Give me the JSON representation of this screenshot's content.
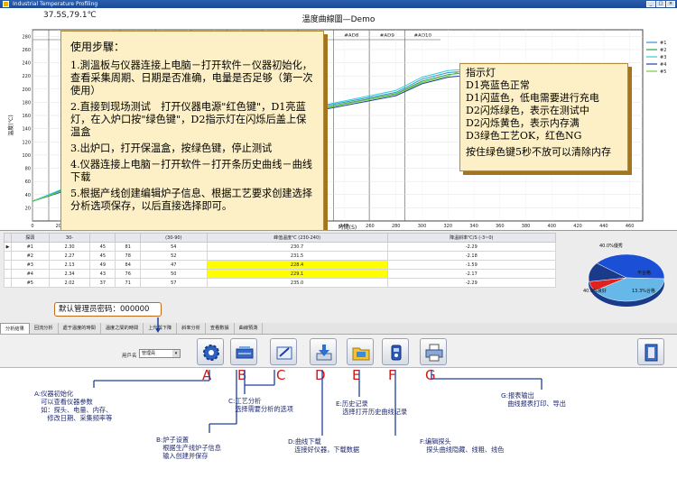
{
  "window": {
    "title": "Industrial Temperature Profiling"
  },
  "readout": "37.5S,79.1℃",
  "chart": {
    "title": "温度曲線圖—Demo",
    "ylabel": "溫度(℃)",
    "xlabel": "時間(S)",
    "zone_labels": [
      "入口",
      "#AD1",
      "#AD2",
      "#AD3",
      "#AD4",
      "#AD5",
      "#AD6",
      "#AD7",
      "#AD8",
      "#AD9",
      "#AD10"
    ],
    "yticks": [
      "280",
      "260",
      "240",
      "220",
      "200",
      "180",
      "160",
      "140",
      "120",
      "100",
      "80",
      "60",
      "40",
      "20"
    ],
    "xticks": [
      "0",
      "20",
      "40",
      "60",
      "80",
      "100",
      "120",
      "140",
      "160",
      "180",
      "200",
      "220",
      "240",
      "260",
      "280",
      "300",
      "320",
      "340",
      "360",
      "380",
      "400",
      "420",
      "440",
      "460"
    ],
    "legend": [
      "#1",
      "#2",
      "#3",
      "#4",
      "#5"
    ],
    "colors": {
      "s1": "#3a8bd8",
      "s2": "#2aa34a",
      "s3": "#2ad0d8",
      "s4": "#1f3f9e",
      "s5": "#6fcf3a"
    }
  },
  "chart_data": {
    "type": "line",
    "xlabel": "時間(S)",
    "ylabel": "溫度(℃)",
    "xlim": [
      0,
      470
    ],
    "ylim": [
      0,
      290
    ],
    "series": [
      {
        "name": "#1",
        "x": [
          0,
          40,
          80,
          120,
          160,
          200,
          240,
          280,
          300,
          320,
          340,
          360,
          380,
          400,
          420,
          440,
          460
        ],
        "y": [
          30,
          60,
          100,
          130,
          150,
          165,
          180,
          195,
          215,
          225,
          228,
          226,
          210,
          190,
          175,
          165,
          155
        ]
      },
      {
        "name": "#2",
        "x": [
          0,
          40,
          80,
          120,
          160,
          200,
          240,
          280,
          300,
          320,
          340,
          360,
          380,
          400,
          420,
          440,
          460
        ],
        "y": [
          30,
          58,
          98,
          128,
          148,
          162,
          178,
          193,
          212,
          222,
          226,
          224,
          212,
          195,
          180,
          168,
          158
        ]
      },
      {
        "name": "#3",
        "x": [
          0,
          40,
          80,
          120,
          160,
          200,
          240,
          280,
          300,
          320,
          340,
          360,
          380,
          400,
          420,
          440,
          460
        ],
        "y": [
          30,
          62,
          102,
          132,
          152,
          166,
          182,
          198,
          218,
          228,
          231,
          229,
          215,
          200,
          185,
          172,
          160
        ]
      },
      {
        "name": "#4",
        "x": [
          0,
          40,
          80,
          120,
          160,
          200,
          240,
          280,
          300,
          320,
          340,
          360,
          380,
          400,
          420,
          440,
          460
        ],
        "y": [
          30,
          55,
          95,
          125,
          145,
          160,
          175,
          190,
          208,
          218,
          222,
          221,
          208,
          192,
          178,
          166,
          156
        ]
      },
      {
        "name": "#5",
        "x": [
          0,
          40,
          80,
          120,
          160,
          200,
          240,
          280,
          300,
          320,
          340,
          360,
          380,
          400,
          420,
          440,
          460
        ],
        "y": [
          30,
          57,
          97,
          127,
          147,
          161,
          177,
          192,
          210,
          220,
          235,
          232,
          216,
          198,
          182,
          170,
          160
        ]
      }
    ]
  },
  "steps_note": {
    "heading": "使用步驟：",
    "steps": [
      "1.測溫板与仪器连接上电脑－打开软件－仪器初始化，查看采集周期、日期是否准确，电量是否足够（第一次使用）",
      "2.直接到现场测试　打开仪器电源\"红色键\"，D1亮蓝灯，在入炉口按\"绿色键\"，D2指示灯在闪烁后盖上保温盒",
      "3.出炉口，打开保温盒，按绿色键，停止测试",
      "4.仪器连接上电脑－打开软件－打开条历史曲线－曲线下载",
      "5.根据产线创建编辑炉子信息、根据工艺要求创建选择分析选项保存，以后直接选择即可。"
    ]
  },
  "indicator_note": {
    "lines": [
      "指示灯",
      "D1亮蓝色正常",
      "D1闪蓝色，低电需要进行充电",
      "D2闪烁绿色，表示在测试中",
      "D2闪烁黄色，表示内存满",
      "D3绿色工艺OK，红色NG"
    ],
    "clear": "按住绿色键5秒不放可以清除内存"
  },
  "table": {
    "headers": [
      "探頭",
      "30-",
      "",
      "",
      "(30-90)",
      "峰值溫度℃ (230-240)",
      "降溫斜率℃/S (-3~0)"
    ],
    "rows": [
      {
        "selector": "▶",
        "probe": "#1",
        "c1": "2.30",
        "c2": "45",
        "c3": "81",
        "c4": "54",
        "peak": "230.7",
        "slope": "-2.29",
        "hl": false
      },
      {
        "selector": "",
        "probe": "#2",
        "c1": "2.27",
        "c2": "45",
        "c3": "78",
        "c4": "52",
        "peak": "231.5",
        "slope": "-2.18",
        "hl": false
      },
      {
        "selector": "",
        "probe": "#3",
        "c1": "2.13",
        "c2": "49",
        "c3": "84",
        "c4": "47",
        "peak": "228.4",
        "slope": "-1.59",
        "hl": true
      },
      {
        "selector": "",
        "probe": "#4",
        "c1": "2.34",
        "c2": "43",
        "c3": "76",
        "c4": "50",
        "peak": "229.1",
        "slope": "-2.17",
        "hl": true
      },
      {
        "selector": "",
        "probe": "#5",
        "c1": "2.02",
        "c2": "37",
        "c3": "71",
        "c4": "57",
        "peak": "235.0",
        "slope": "-2.29",
        "hl": false
      }
    ]
  },
  "pie": {
    "slice_labels": [
      "40.0%優秀",
      "40.0%良好",
      "不合格",
      "13.3%合格"
    ],
    "values": [
      40.0,
      40.0,
      6.7,
      13.3
    ],
    "colors": {
      "excellent": "#1a4fd6",
      "good": "#66b8e8",
      "fail": "#e0221f",
      "pass": "#1a3a8a"
    }
  },
  "password": "默认管理员密码：000000",
  "tabs": [
    "分析結果",
    "回流分析",
    "處于溫度的時間",
    "溫度之間的時間",
    "上升與下降",
    "斜率分析",
    "查看數據",
    "曲線預測"
  ],
  "toolbar": {
    "user_label": "用戶名",
    "user_value": "管理員"
  },
  "letters": [
    "A",
    "B",
    "C",
    "D",
    "E",
    "F",
    "G"
  ],
  "callouts": {
    "A": [
      "A:仪器初始化",
      "　可以查看仪器参数",
      "　如：探头、电量、内存、",
      "　　修改日期、采集频率等"
    ],
    "B": [
      "B:炉子设置",
      "　根据生产线炉子信息",
      "　输入创建并保存"
    ],
    "C": [
      "C:工艺分析",
      "　选择需要分析的选项"
    ],
    "D": [
      "D:曲线下载",
      "　连接好仪器，下载数据"
    ],
    "E": [
      "E:历史记录",
      "　选择打开历史曲线记录"
    ],
    "F": [
      "F:编辑探头",
      "　探头曲线隐藏、线粗、线色"
    ],
    "G": [
      "G:报表输出",
      "　曲线报表打印、导出"
    ]
  }
}
